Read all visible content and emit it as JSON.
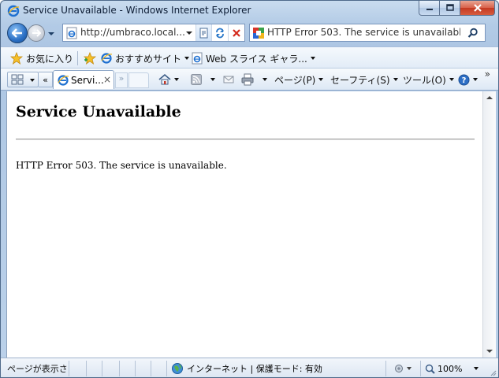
{
  "window": {
    "title": "Service Unavailable - Windows Internet Explorer"
  },
  "navigation": {
    "address": "http://umbraco.local...",
    "search_text": "HTTP Error 503. The service is unavailable."
  },
  "favorites_bar": {
    "favorites_label": "お気に入り",
    "suggested_sites_label": "おすすめサイト",
    "web_slice_label": "Web スライス ギャラ..."
  },
  "tabs": {
    "active_label": "Servi...",
    "close_glyph": "×",
    "list_glyph": "«",
    "more_glyph": "»"
  },
  "command_bar": {
    "page_label": "ページ(P)",
    "safety_label": "セーフティ(S)",
    "tools_label": "ツール(O)",
    "overflow_glyph": "»"
  },
  "page": {
    "title": "Service Unavailable",
    "message": "HTTP Error 503. The service is unavailable."
  },
  "status_bar": {
    "status_text": "ページが表示さ",
    "zone_text": "インターネット | 保護モード: 有効",
    "zoom_text": "100%"
  },
  "colors": {
    "accent": "#2a6fc4",
    "close_button": "#c43a22"
  }
}
